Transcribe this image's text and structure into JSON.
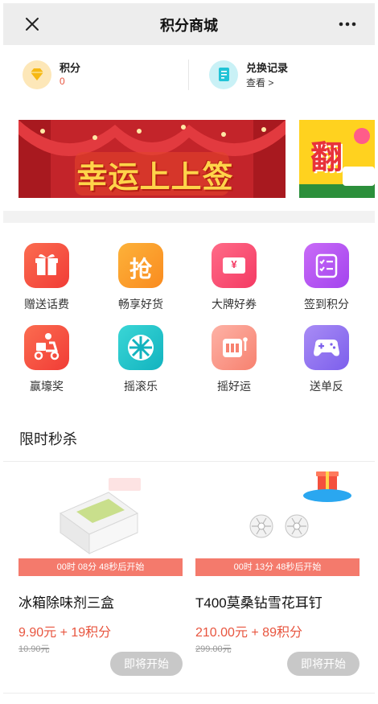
{
  "header": {
    "title": "积分商城",
    "close_icon": "close-icon",
    "more_icon": "more-dots-icon"
  },
  "points": {
    "label": "积分",
    "value": "0"
  },
  "exchange": {
    "label": "兑换记录",
    "link": "查看 >"
  },
  "banners": [
    {
      "text": "幸运上上签"
    },
    {
      "text": "翻"
    }
  ],
  "grid": [
    {
      "label": "赠送话费",
      "icon": "gift-icon",
      "color": "#f4553d"
    },
    {
      "label": "畅享好货",
      "icon": "grab-icon",
      "color": "#fa9a24",
      "glyph": "抢"
    },
    {
      "label": "大牌好券",
      "icon": "coupon-icon",
      "color": "#f8476b",
      "glyph": "¥"
    },
    {
      "label": "签到积分",
      "icon": "checklist-icon",
      "color": "#b554f0"
    },
    {
      "label": "赢壕奖",
      "icon": "delivery-scooter-icon",
      "color": "#f4553d"
    },
    {
      "label": "摇滚乐",
      "icon": "wheel-icon",
      "color": "#22c3c9"
    },
    {
      "label": "摇好运",
      "icon": "slot-machine-icon",
      "color": "#f98e80"
    },
    {
      "label": "送单反",
      "icon": "gamepad-icon",
      "color": "#8a6cf0"
    }
  ],
  "flash_sale": {
    "title": "限时秒杀",
    "products": [
      {
        "name": "冰箱除味剂三盒",
        "countdown": "00时 08分 48秒后开始",
        "price": "9.90元 + 19积分",
        "original": "10.90元",
        "button": "即将开始"
      },
      {
        "name": "T400莫桑钻雪花耳钉",
        "countdown": "00时 13分 48秒后开始",
        "price": "210.00元 + 89积分",
        "original": "299.00元",
        "button": "即将开始"
      }
    ]
  },
  "colors": {
    "accent": "#e8553f",
    "countdown_bg": "#f47a6c",
    "button_disabled": "#c8c8c8"
  }
}
